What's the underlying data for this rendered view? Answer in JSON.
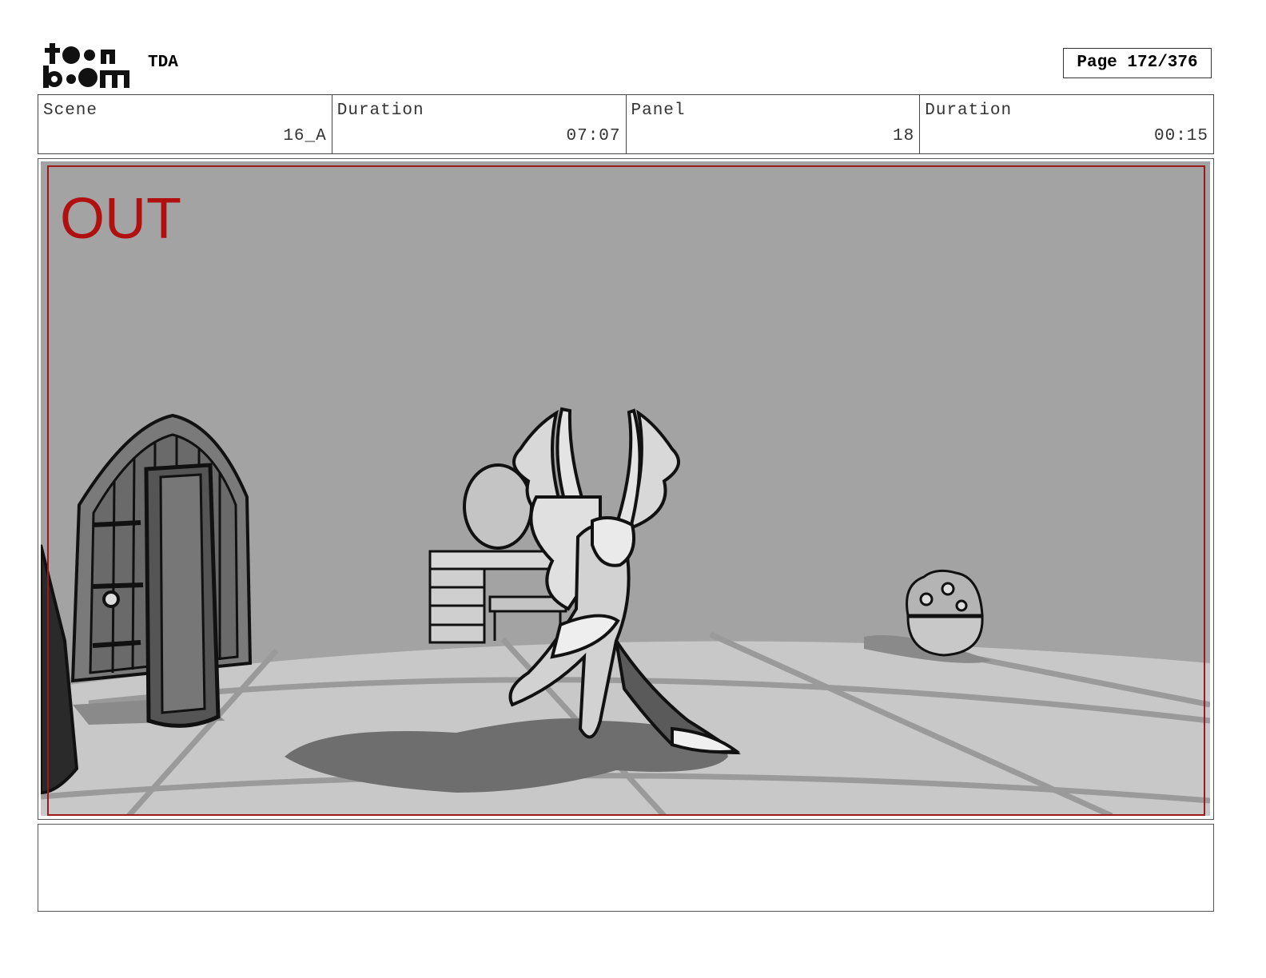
{
  "header": {
    "logo_text_top": "toon",
    "logo_text_bottom": "boom",
    "project": "TDA",
    "page": "Page 172/376"
  },
  "info": {
    "scene_label": "Scene",
    "scene_value": "16_A",
    "scene_duration_label": "Duration",
    "scene_duration_value": "07:07",
    "panel_label": "Panel",
    "panel_value": "18",
    "panel_duration_label": "Duration",
    "panel_duration_value": "00:15"
  },
  "panel": {
    "transition_label": "OUT",
    "transition_color": "#b01010"
  },
  "notes": {
    "text": ""
  }
}
